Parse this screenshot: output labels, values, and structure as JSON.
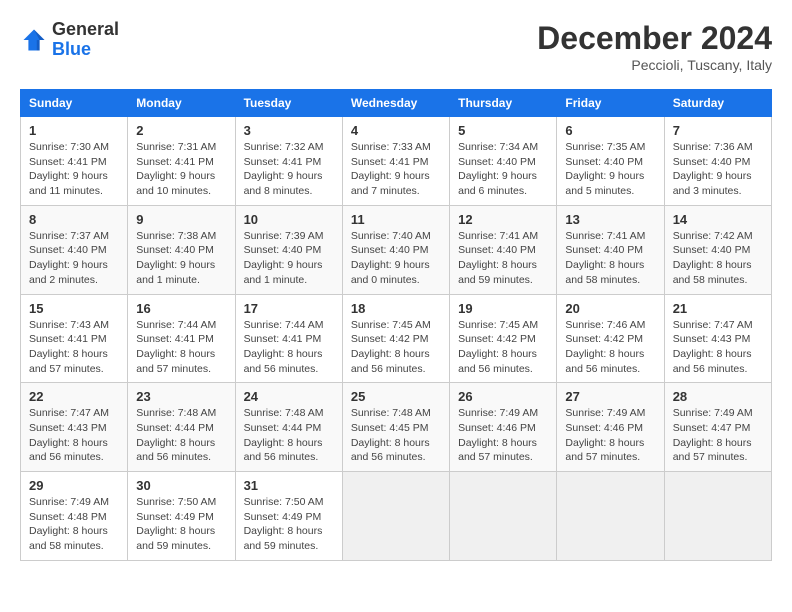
{
  "header": {
    "logo_general": "General",
    "logo_blue": "Blue",
    "month_title": "December 2024",
    "subtitle": "Peccioli, Tuscany, Italy"
  },
  "days_of_week": [
    "Sunday",
    "Monday",
    "Tuesday",
    "Wednesday",
    "Thursday",
    "Friday",
    "Saturday"
  ],
  "weeks": [
    [
      {
        "num": "1",
        "sunrise": "7:30 AM",
        "sunset": "4:41 PM",
        "daylight": "9 hours and 11 minutes."
      },
      {
        "num": "2",
        "sunrise": "7:31 AM",
        "sunset": "4:41 PM",
        "daylight": "9 hours and 10 minutes."
      },
      {
        "num": "3",
        "sunrise": "7:32 AM",
        "sunset": "4:41 PM",
        "daylight": "9 hours and 8 minutes."
      },
      {
        "num": "4",
        "sunrise": "7:33 AM",
        "sunset": "4:41 PM",
        "daylight": "9 hours and 7 minutes."
      },
      {
        "num": "5",
        "sunrise": "7:34 AM",
        "sunset": "4:40 PM",
        "daylight": "9 hours and 6 minutes."
      },
      {
        "num": "6",
        "sunrise": "7:35 AM",
        "sunset": "4:40 PM",
        "daylight": "9 hours and 5 minutes."
      },
      {
        "num": "7",
        "sunrise": "7:36 AM",
        "sunset": "4:40 PM",
        "daylight": "9 hours and 3 minutes."
      }
    ],
    [
      {
        "num": "8",
        "sunrise": "7:37 AM",
        "sunset": "4:40 PM",
        "daylight": "9 hours and 2 minutes."
      },
      {
        "num": "9",
        "sunrise": "7:38 AM",
        "sunset": "4:40 PM",
        "daylight": "9 hours and 1 minute."
      },
      {
        "num": "10",
        "sunrise": "7:39 AM",
        "sunset": "4:40 PM",
        "daylight": "9 hours and 1 minute."
      },
      {
        "num": "11",
        "sunrise": "7:40 AM",
        "sunset": "4:40 PM",
        "daylight": "9 hours and 0 minutes."
      },
      {
        "num": "12",
        "sunrise": "7:41 AM",
        "sunset": "4:40 PM",
        "daylight": "8 hours and 59 minutes."
      },
      {
        "num": "13",
        "sunrise": "7:41 AM",
        "sunset": "4:40 PM",
        "daylight": "8 hours and 58 minutes."
      },
      {
        "num": "14",
        "sunrise": "7:42 AM",
        "sunset": "4:40 PM",
        "daylight": "8 hours and 58 minutes."
      }
    ],
    [
      {
        "num": "15",
        "sunrise": "7:43 AM",
        "sunset": "4:41 PM",
        "daylight": "8 hours and 57 minutes."
      },
      {
        "num": "16",
        "sunrise": "7:44 AM",
        "sunset": "4:41 PM",
        "daylight": "8 hours and 57 minutes."
      },
      {
        "num": "17",
        "sunrise": "7:44 AM",
        "sunset": "4:41 PM",
        "daylight": "8 hours and 56 minutes."
      },
      {
        "num": "18",
        "sunrise": "7:45 AM",
        "sunset": "4:42 PM",
        "daylight": "8 hours and 56 minutes."
      },
      {
        "num": "19",
        "sunrise": "7:45 AM",
        "sunset": "4:42 PM",
        "daylight": "8 hours and 56 minutes."
      },
      {
        "num": "20",
        "sunrise": "7:46 AM",
        "sunset": "4:42 PM",
        "daylight": "8 hours and 56 minutes."
      },
      {
        "num": "21",
        "sunrise": "7:47 AM",
        "sunset": "4:43 PM",
        "daylight": "8 hours and 56 minutes."
      }
    ],
    [
      {
        "num": "22",
        "sunrise": "7:47 AM",
        "sunset": "4:43 PM",
        "daylight": "8 hours and 56 minutes."
      },
      {
        "num": "23",
        "sunrise": "7:48 AM",
        "sunset": "4:44 PM",
        "daylight": "8 hours and 56 minutes."
      },
      {
        "num": "24",
        "sunrise": "7:48 AM",
        "sunset": "4:44 PM",
        "daylight": "8 hours and 56 minutes."
      },
      {
        "num": "25",
        "sunrise": "7:48 AM",
        "sunset": "4:45 PM",
        "daylight": "8 hours and 56 minutes."
      },
      {
        "num": "26",
        "sunrise": "7:49 AM",
        "sunset": "4:46 PM",
        "daylight": "8 hours and 57 minutes."
      },
      {
        "num": "27",
        "sunrise": "7:49 AM",
        "sunset": "4:46 PM",
        "daylight": "8 hours and 57 minutes."
      },
      {
        "num": "28",
        "sunrise": "7:49 AM",
        "sunset": "4:47 PM",
        "daylight": "8 hours and 57 minutes."
      }
    ],
    [
      {
        "num": "29",
        "sunrise": "7:49 AM",
        "sunset": "4:48 PM",
        "daylight": "8 hours and 58 minutes."
      },
      {
        "num": "30",
        "sunrise": "7:50 AM",
        "sunset": "4:49 PM",
        "daylight": "8 hours and 59 minutes."
      },
      {
        "num": "31",
        "sunrise": "7:50 AM",
        "sunset": "4:49 PM",
        "daylight": "8 hours and 59 minutes."
      },
      null,
      null,
      null,
      null
    ]
  ]
}
